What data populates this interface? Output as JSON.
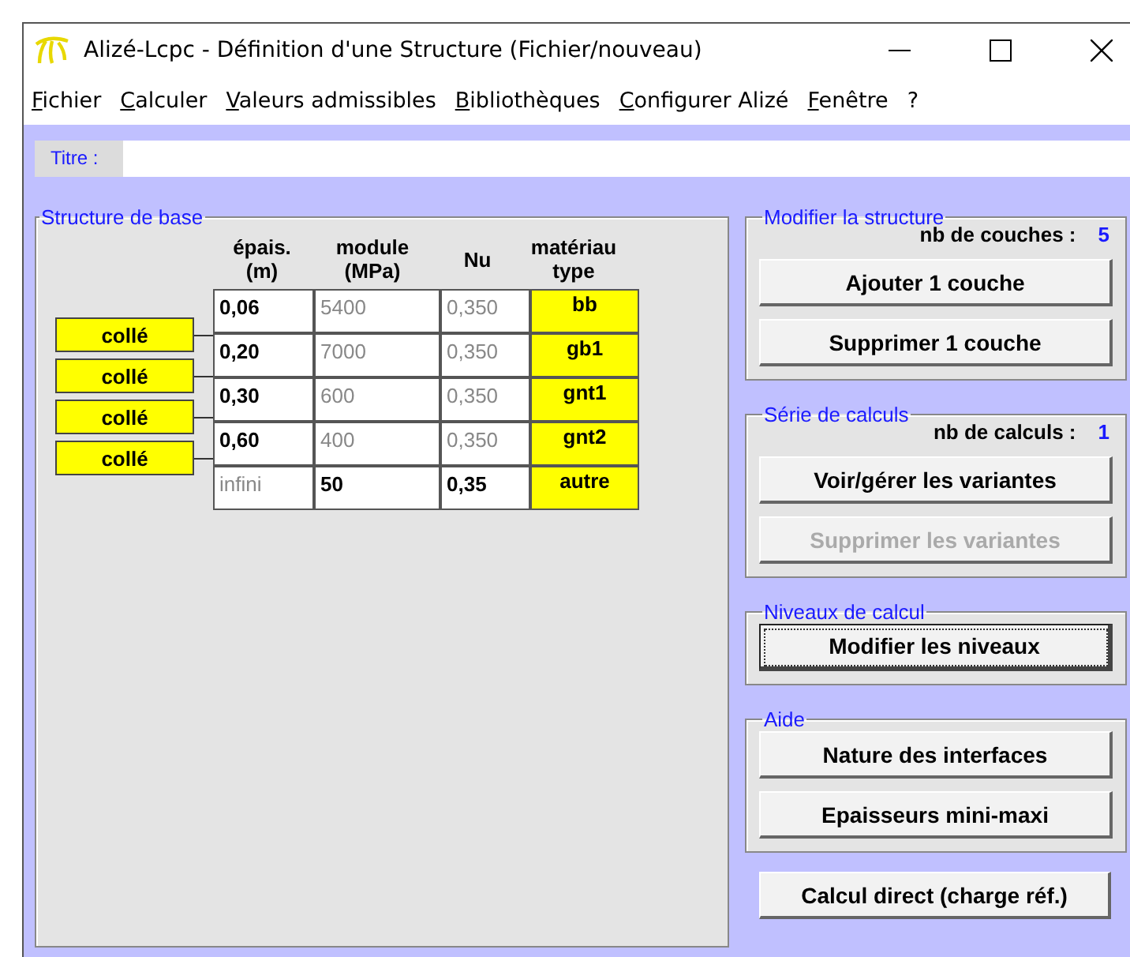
{
  "window": {
    "title": "Alizé-Lcpc - Définition d'une Structure (Fichier/nouveau)"
  },
  "menu": [
    {
      "label": "Fichier",
      "underlined": true
    },
    {
      "label": "Calculer",
      "underlined": true
    },
    {
      "label": "Valeurs admissibles",
      "underlined": true
    },
    {
      "label": "Bibliothèques",
      "underlined": true
    },
    {
      "label": "Configurer Alizé",
      "underlined": true
    },
    {
      "label": "Fenêtre",
      "underlined": true
    },
    {
      "label": "?",
      "underlined": false
    }
  ],
  "title_field": {
    "label": "Titre :"
  },
  "structure": {
    "legend": "Structure de base",
    "columns": [
      "épais.\n(m)",
      "module\n(MPa)",
      "Nu",
      "matériau\ntype"
    ],
    "rows": [
      {
        "cells": [
          {
            "text": "0,06",
            "bold": true
          },
          {
            "text": "5400",
            "bold": false
          },
          {
            "text": "0,350",
            "bold": false
          },
          {
            "text": "bb",
            "bold": true
          }
        ]
      },
      {
        "cells": [
          {
            "text": "0,20",
            "bold": true
          },
          {
            "text": "7000",
            "bold": false
          },
          {
            "text": "0,350",
            "bold": false
          },
          {
            "text": "gb1",
            "bold": true
          }
        ]
      },
      {
        "cells": [
          {
            "text": "0,30",
            "bold": true
          },
          {
            "text": "600",
            "bold": false
          },
          {
            "text": "0,350",
            "bold": false
          },
          {
            "text": "gnt1",
            "bold": true
          }
        ]
      },
      {
        "cells": [
          {
            "text": "0,60",
            "bold": true
          },
          {
            "text": "400",
            "bold": false
          },
          {
            "text": "0,350",
            "bold": false
          },
          {
            "text": "gnt2",
            "bold": true
          }
        ]
      },
      {
        "cells": [
          {
            "text": "infini",
            "bold": false
          },
          {
            "text": "50",
            "bold": true
          },
          {
            "text": "0,35",
            "bold": true
          },
          {
            "text": "autre",
            "bold": true
          }
        ]
      }
    ],
    "interfaces": [
      "collé",
      "collé",
      "collé",
      "collé"
    ]
  },
  "panels": [
    {
      "legend": "Modifier la structure",
      "info": {
        "label": "nb de couches :",
        "value": "5"
      },
      "buttons": [
        {
          "label": "Ajouter 1 couche",
          "disabled": false,
          "focused": false
        },
        {
          "label": "Supprimer 1 couche",
          "disabled": false,
          "focused": false
        }
      ]
    },
    {
      "legend": "Série de calculs",
      "info": {
        "label": "nb de calculs :",
        "value": "1"
      },
      "buttons": [
        {
          "label": "Voir/gérer les variantes",
          "disabled": false,
          "focused": false
        },
        {
          "label": "Supprimer les variantes",
          "disabled": true,
          "focused": false
        }
      ]
    },
    {
      "legend": "Niveaux de calcul",
      "buttons": [
        {
          "label": "Modifier les niveaux",
          "disabled": false,
          "focused": true
        }
      ]
    },
    {
      "legend": "Aide",
      "buttons": [
        {
          "label": "Nature des interfaces",
          "disabled": false,
          "focused": false
        },
        {
          "label": "Epaisseurs mini-maxi",
          "disabled": false,
          "focused": false
        }
      ]
    }
  ],
  "bottom_button": {
    "label": "Calcul direct (charge réf.)"
  }
}
